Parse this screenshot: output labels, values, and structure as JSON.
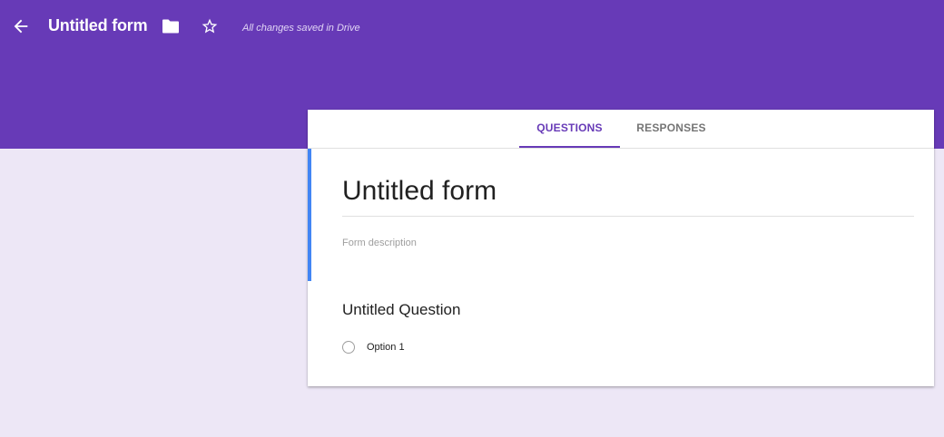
{
  "header": {
    "back_icon": "arrow-back-icon",
    "title": "Untitled form",
    "folder_icon": "folder-icon",
    "star_icon": "star-outline-icon",
    "save_status": "All changes saved in Drive",
    "color": "#673ab7"
  },
  "tabs": [
    {
      "label": "QUESTIONS",
      "active": true
    },
    {
      "label": "RESPONSES",
      "active": false
    }
  ],
  "form": {
    "title": "Untitled form",
    "description_placeholder": "Form description",
    "accent_color": "#4285f4"
  },
  "question": {
    "title": "Untitled Question",
    "options": [
      {
        "label": "Option 1"
      }
    ]
  },
  "page": {
    "background": "#ede7f6"
  }
}
